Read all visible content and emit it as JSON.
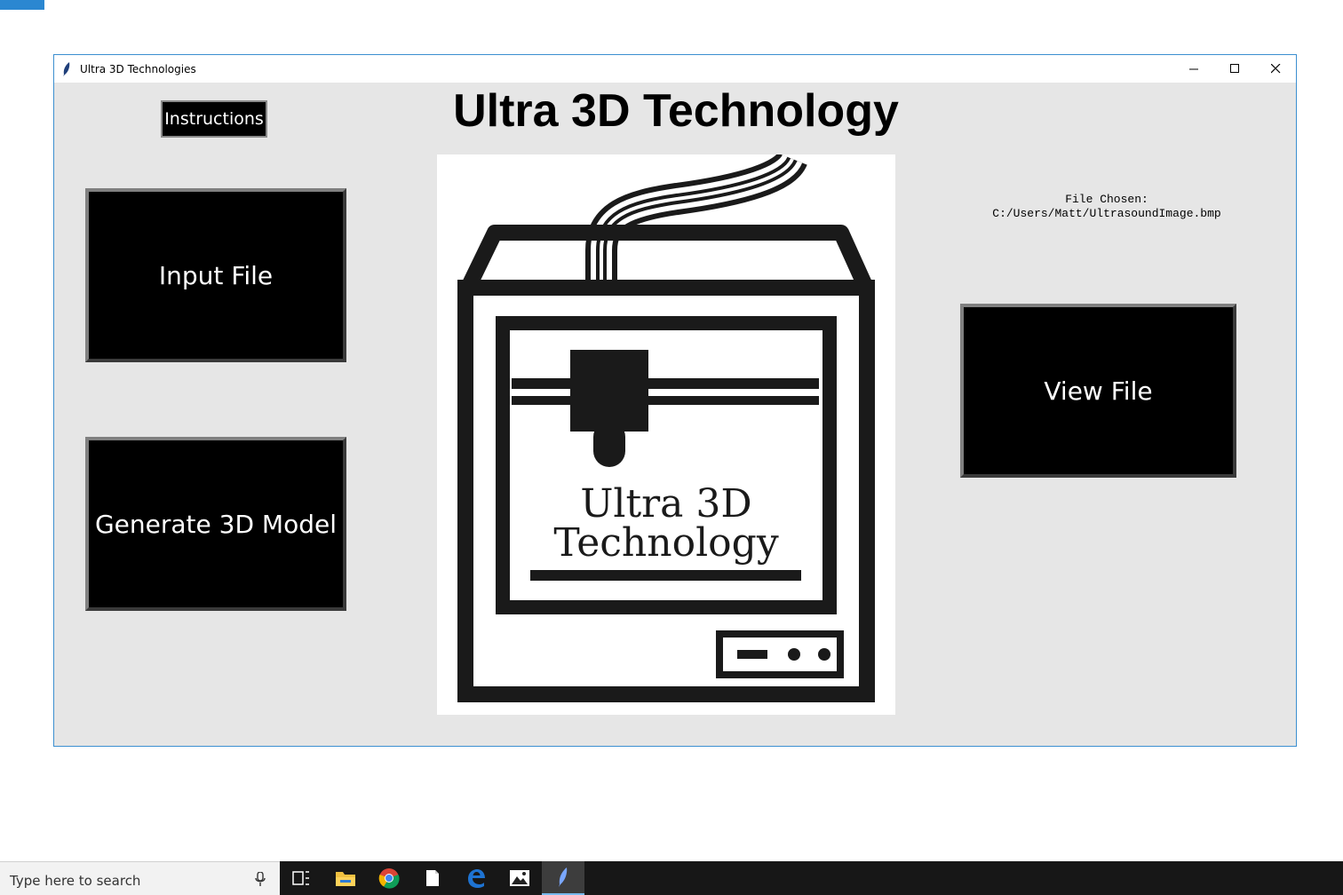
{
  "window": {
    "title": "Ultra 3D Technologies"
  },
  "app": {
    "heading": "Ultra 3D Technology",
    "instructions_label": "Instructions",
    "input_file_label": "Input File",
    "generate_label": "Generate 3D Model",
    "view_file_label": "View File",
    "file_chosen_label": "File Chosen:",
    "file_chosen_path": "C:/Users/Matt/UltrasoundImage.bmp",
    "logo_text_line1": "Ultra 3D",
    "logo_text_line2": "Technology"
  },
  "taskbar": {
    "search_placeholder": "Type here to search",
    "icons": [
      "task-view-icon",
      "file-explorer-icon",
      "chrome-icon",
      "notepad-icon",
      "edge-icon",
      "photos-icon",
      "python-feather-icon"
    ]
  },
  "colors": {
    "window_bg": "#e6e6e6",
    "button_bg": "#000000",
    "accent": "#3c8fd0",
    "taskbar_bg": "#171717"
  }
}
